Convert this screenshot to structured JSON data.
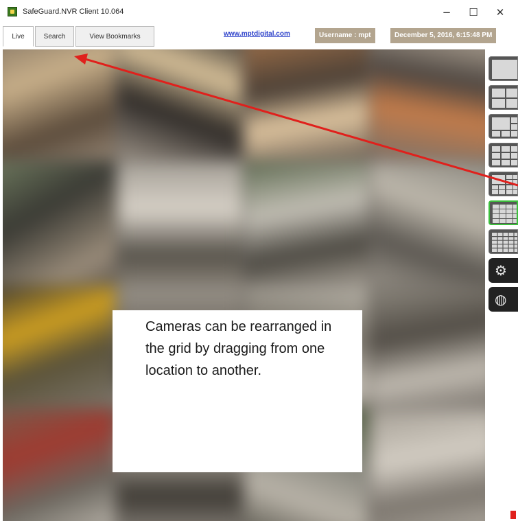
{
  "window": {
    "title": "SafeGuard.NVR Client 10.064",
    "minimize_glyph": "−",
    "maximize_glyph": "☐",
    "close_glyph": "✕"
  },
  "tabs": [
    {
      "label": "Live",
      "active": true
    },
    {
      "label": "Search",
      "active": false
    },
    {
      "label": "View Bookmarks",
      "active": false
    }
  ],
  "header": {
    "link": "www.mptdigital.com",
    "username": "Username : mpt",
    "datetime": "December 5, 2016, 6:15:48 PM"
  },
  "note": {
    "text": "Cameras can be rearranged in the grid by dragging from one location to another."
  },
  "sidebar": {
    "layouts": [
      "1x1",
      "2x2",
      "1+5",
      "3x3",
      "1+12",
      "4x4",
      "5x5"
    ],
    "active_layout": "4x4",
    "settings_icon": "gear-icon",
    "network_icon": "globe-icon"
  },
  "colors": {
    "badge": "#b3a58f",
    "link": "#2a3fc9",
    "annotation_arrow": "#e0201c",
    "active_layout_border": "#3cbf3c"
  }
}
